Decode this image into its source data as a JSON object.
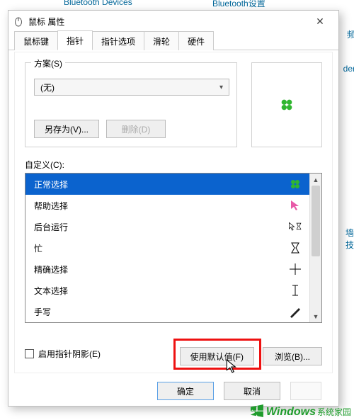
{
  "bg": {
    "top_items": [
      "Bluetooth Devices",
      "Bluetooth设置"
    ],
    "right_items": [
      "频",
      "der",
      "墙技"
    ]
  },
  "dialog": {
    "title": "鼠标 属性",
    "close_glyph": "✕",
    "tabs": [
      {
        "label": "鼠标键",
        "active": false
      },
      {
        "label": "指针",
        "active": true
      },
      {
        "label": "指针选项",
        "active": false
      },
      {
        "label": "滑轮",
        "active": false
      },
      {
        "label": "硬件",
        "active": false
      }
    ],
    "scheme": {
      "legend": "方案(S)",
      "selected": "(无)",
      "save_as": "另存为(V)...",
      "delete": "删除(D)"
    },
    "custom_label": "自定义(C):",
    "rows": [
      {
        "label": "正常选择",
        "icon": "clover-green",
        "selected": true
      },
      {
        "label": "帮助选择",
        "icon": "pointer-pink",
        "selected": false
      },
      {
        "label": "后台运行",
        "icon": "arrow-hourglass",
        "selected": false
      },
      {
        "label": "忙",
        "icon": "hourglass",
        "selected": false
      },
      {
        "label": "精确选择",
        "icon": "crosshair",
        "selected": false
      },
      {
        "label": "文本选择",
        "icon": "ibeam",
        "selected": false
      },
      {
        "label": "手写",
        "icon": "pen",
        "selected": false
      }
    ],
    "shadow_checkbox": "启用指针阴影(E)",
    "use_defaults": "使用默认值(F)",
    "browse": "浏览(B)...",
    "ok": "确定",
    "cancel": "取消"
  },
  "watermark": {
    "brand": "Windows",
    "sub": "系统家园"
  }
}
